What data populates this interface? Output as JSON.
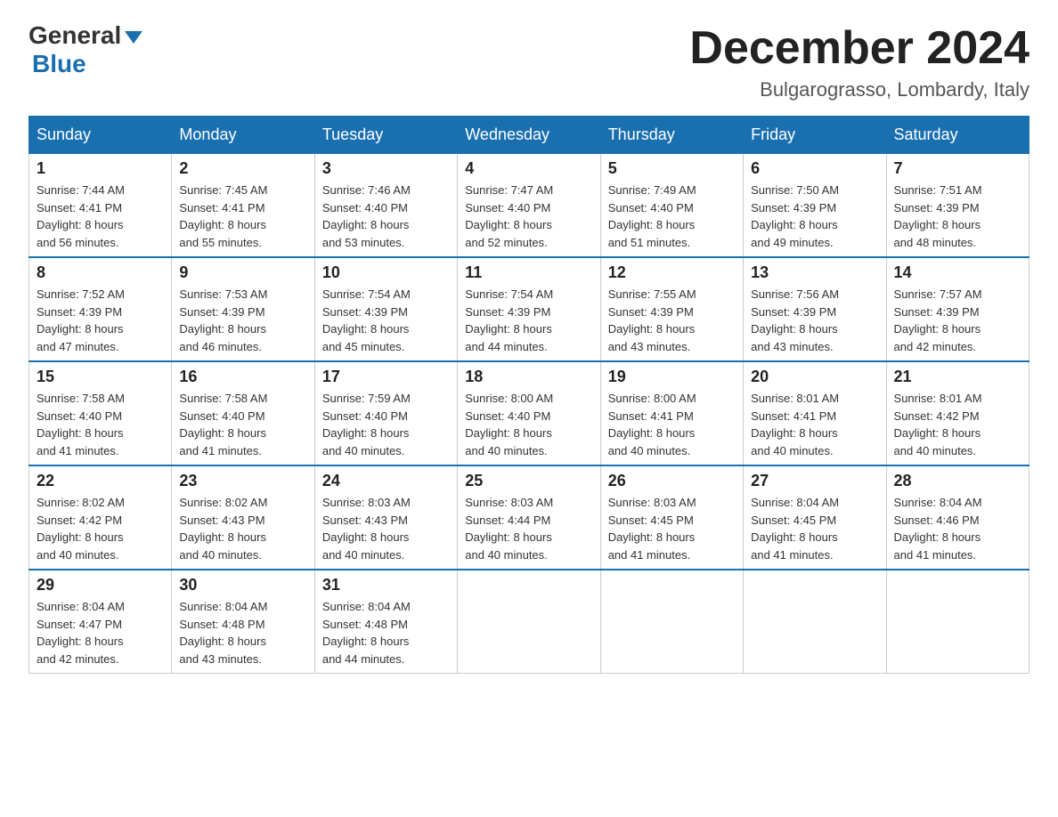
{
  "header": {
    "logo_general": "General",
    "logo_blue": "Blue",
    "title": "December 2024",
    "subtitle": "Bulgarograsso, Lombardy, Italy"
  },
  "days_of_week": [
    "Sunday",
    "Monday",
    "Tuesday",
    "Wednesday",
    "Thursday",
    "Friday",
    "Saturday"
  ],
  "weeks": [
    [
      {
        "day": "1",
        "sunrise": "7:44 AM",
        "sunset": "4:41 PM",
        "daylight": "8 hours and 56 minutes."
      },
      {
        "day": "2",
        "sunrise": "7:45 AM",
        "sunset": "4:41 PM",
        "daylight": "8 hours and 55 minutes."
      },
      {
        "day": "3",
        "sunrise": "7:46 AM",
        "sunset": "4:40 PM",
        "daylight": "8 hours and 53 minutes."
      },
      {
        "day": "4",
        "sunrise": "7:47 AM",
        "sunset": "4:40 PM",
        "daylight": "8 hours and 52 minutes."
      },
      {
        "day": "5",
        "sunrise": "7:49 AM",
        "sunset": "4:40 PM",
        "daylight": "8 hours and 51 minutes."
      },
      {
        "day": "6",
        "sunrise": "7:50 AM",
        "sunset": "4:39 PM",
        "daylight": "8 hours and 49 minutes."
      },
      {
        "day": "7",
        "sunrise": "7:51 AM",
        "sunset": "4:39 PM",
        "daylight": "8 hours and 48 minutes."
      }
    ],
    [
      {
        "day": "8",
        "sunrise": "7:52 AM",
        "sunset": "4:39 PM",
        "daylight": "8 hours and 47 minutes."
      },
      {
        "day": "9",
        "sunrise": "7:53 AM",
        "sunset": "4:39 PM",
        "daylight": "8 hours and 46 minutes."
      },
      {
        "day": "10",
        "sunrise": "7:54 AM",
        "sunset": "4:39 PM",
        "daylight": "8 hours and 45 minutes."
      },
      {
        "day": "11",
        "sunrise": "7:54 AM",
        "sunset": "4:39 PM",
        "daylight": "8 hours and 44 minutes."
      },
      {
        "day": "12",
        "sunrise": "7:55 AM",
        "sunset": "4:39 PM",
        "daylight": "8 hours and 43 minutes."
      },
      {
        "day": "13",
        "sunrise": "7:56 AM",
        "sunset": "4:39 PM",
        "daylight": "8 hours and 43 minutes."
      },
      {
        "day": "14",
        "sunrise": "7:57 AM",
        "sunset": "4:39 PM",
        "daylight": "8 hours and 42 minutes."
      }
    ],
    [
      {
        "day": "15",
        "sunrise": "7:58 AM",
        "sunset": "4:40 PM",
        "daylight": "8 hours and 41 minutes."
      },
      {
        "day": "16",
        "sunrise": "7:58 AM",
        "sunset": "4:40 PM",
        "daylight": "8 hours and 41 minutes."
      },
      {
        "day": "17",
        "sunrise": "7:59 AM",
        "sunset": "4:40 PM",
        "daylight": "8 hours and 40 minutes."
      },
      {
        "day": "18",
        "sunrise": "8:00 AM",
        "sunset": "4:40 PM",
        "daylight": "8 hours and 40 minutes."
      },
      {
        "day": "19",
        "sunrise": "8:00 AM",
        "sunset": "4:41 PM",
        "daylight": "8 hours and 40 minutes."
      },
      {
        "day": "20",
        "sunrise": "8:01 AM",
        "sunset": "4:41 PM",
        "daylight": "8 hours and 40 minutes."
      },
      {
        "day": "21",
        "sunrise": "8:01 AM",
        "sunset": "4:42 PM",
        "daylight": "8 hours and 40 minutes."
      }
    ],
    [
      {
        "day": "22",
        "sunrise": "8:02 AM",
        "sunset": "4:42 PM",
        "daylight": "8 hours and 40 minutes."
      },
      {
        "day": "23",
        "sunrise": "8:02 AM",
        "sunset": "4:43 PM",
        "daylight": "8 hours and 40 minutes."
      },
      {
        "day": "24",
        "sunrise": "8:03 AM",
        "sunset": "4:43 PM",
        "daylight": "8 hours and 40 minutes."
      },
      {
        "day": "25",
        "sunrise": "8:03 AM",
        "sunset": "4:44 PM",
        "daylight": "8 hours and 40 minutes."
      },
      {
        "day": "26",
        "sunrise": "8:03 AM",
        "sunset": "4:45 PM",
        "daylight": "8 hours and 41 minutes."
      },
      {
        "day": "27",
        "sunrise": "8:04 AM",
        "sunset": "4:45 PM",
        "daylight": "8 hours and 41 minutes."
      },
      {
        "day": "28",
        "sunrise": "8:04 AM",
        "sunset": "4:46 PM",
        "daylight": "8 hours and 41 minutes."
      }
    ],
    [
      {
        "day": "29",
        "sunrise": "8:04 AM",
        "sunset": "4:47 PM",
        "daylight": "8 hours and 42 minutes."
      },
      {
        "day": "30",
        "sunrise": "8:04 AM",
        "sunset": "4:48 PM",
        "daylight": "8 hours and 43 minutes."
      },
      {
        "day": "31",
        "sunrise": "8:04 AM",
        "sunset": "4:48 PM",
        "daylight": "8 hours and 44 minutes."
      },
      null,
      null,
      null,
      null
    ]
  ],
  "labels": {
    "sunrise": "Sunrise:",
    "sunset": "Sunset:",
    "daylight": "Daylight:"
  }
}
